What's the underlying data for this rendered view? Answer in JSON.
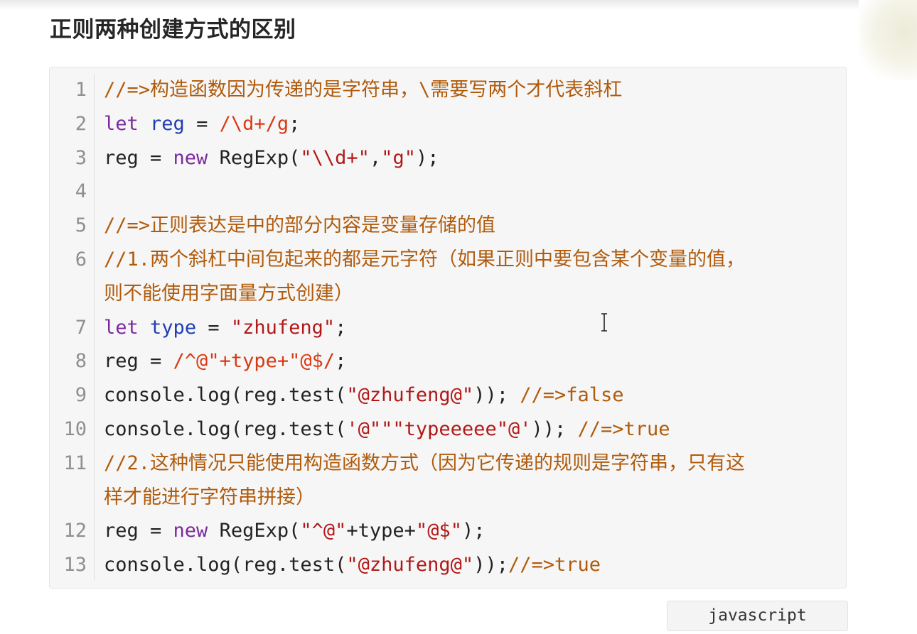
{
  "page": {
    "title": "正则两种创建方式的区别"
  },
  "code": {
    "language": "javascript",
    "lines": [
      {
        "num": "1",
        "parts": [
          {
            "t": "//=>构造函数因为传递的是字符串，\\需要写两个才代表斜杠",
            "c": "comment"
          }
        ]
      },
      {
        "num": "2",
        "parts": [
          {
            "t": "let",
            "c": "kw"
          },
          {
            "t": " ",
            "c": ""
          },
          {
            "t": "reg",
            "c": "var"
          },
          {
            "t": " = ",
            "c": ""
          },
          {
            "t": "/\\d+/g",
            "c": "regex"
          },
          {
            "t": ";",
            "c": ""
          }
        ]
      },
      {
        "num": "3",
        "parts": [
          {
            "t": "reg = ",
            "c": ""
          },
          {
            "t": "new",
            "c": "kw"
          },
          {
            "t": " RegExp(",
            "c": ""
          },
          {
            "t": "\"\\\\d+\"",
            "c": "str"
          },
          {
            "t": ",",
            "c": ""
          },
          {
            "t": "\"g\"",
            "c": "str"
          },
          {
            "t": ");",
            "c": ""
          }
        ]
      },
      {
        "num": "4",
        "parts": []
      },
      {
        "num": "5",
        "parts": [
          {
            "t": "//=>正则表达是中的部分内容是变量存储的值",
            "c": "comment"
          }
        ]
      },
      {
        "num": "6",
        "parts": [
          {
            "t": "//1.两个斜杠中间包起来的都是元字符（如果正则中要包含某个变量的值，",
            "c": "comment"
          }
        ]
      },
      {
        "num": "",
        "parts": [
          {
            "t": "则不能使用字面量方式创建）",
            "c": "comment"
          }
        ]
      },
      {
        "num": "7",
        "parts": [
          {
            "t": "let",
            "c": "kw"
          },
          {
            "t": " ",
            "c": ""
          },
          {
            "t": "type",
            "c": "var"
          },
          {
            "t": " = ",
            "c": ""
          },
          {
            "t": "\"zhufeng\"",
            "c": "str"
          },
          {
            "t": ";",
            "c": ""
          }
        ]
      },
      {
        "num": "8",
        "parts": [
          {
            "t": "reg = ",
            "c": ""
          },
          {
            "t": "/^@\"+type+\"@$/",
            "c": "regex"
          },
          {
            "t": ";",
            "c": ""
          }
        ]
      },
      {
        "num": "9",
        "parts": [
          {
            "t": "console.log(reg.test(",
            "c": ""
          },
          {
            "t": "\"@zhufeng@\"",
            "c": "str"
          },
          {
            "t": ")); ",
            "c": ""
          },
          {
            "t": "//=>false",
            "c": "comment"
          }
        ]
      },
      {
        "num": "10",
        "parts": [
          {
            "t": "console.log(reg.test(",
            "c": ""
          },
          {
            "t": "'@\"\"\"typeeeee\"@'",
            "c": "str"
          },
          {
            "t": ")); ",
            "c": ""
          },
          {
            "t": "//=>true",
            "c": "comment"
          }
        ]
      },
      {
        "num": "11",
        "parts": [
          {
            "t": "//2.这种情况只能使用构造函数方式（因为它传递的规则是字符串，只有这",
            "c": "comment"
          }
        ]
      },
      {
        "num": "",
        "parts": [
          {
            "t": "样才能进行字符串拼接）",
            "c": "comment"
          }
        ]
      },
      {
        "num": "12",
        "parts": [
          {
            "t": "reg = ",
            "c": ""
          },
          {
            "t": "new",
            "c": "kw"
          },
          {
            "t": " RegExp(",
            "c": ""
          },
          {
            "t": "\"^@\"",
            "c": "str"
          },
          {
            "t": "+type+",
            "c": ""
          },
          {
            "t": "\"@$\"",
            "c": "str"
          },
          {
            "t": ");",
            "c": ""
          }
        ]
      },
      {
        "num": "13",
        "parts": [
          {
            "t": "console.log(reg.test(",
            "c": ""
          },
          {
            "t": "\"@zhufeng@\"",
            "c": "str"
          },
          {
            "t": "));",
            "c": ""
          },
          {
            "t": "//=>true",
            "c": "comment"
          }
        ]
      }
    ]
  },
  "cursor": {
    "icon": "text-cursor-icon"
  }
}
